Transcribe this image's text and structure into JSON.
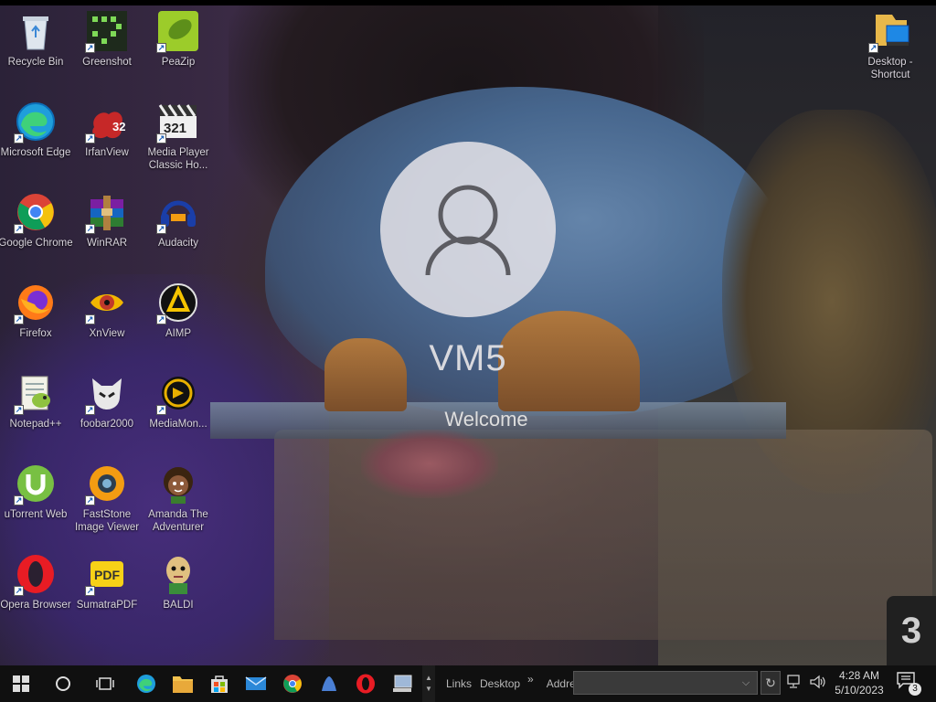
{
  "desktop": {
    "icons": [
      {
        "label": "Recycle Bin",
        "icon": "recycle-bin-icon"
      },
      {
        "label": "Greenshot",
        "icon": "greenshot-icon"
      },
      {
        "label": "PeaZip",
        "icon": "peazip-icon"
      },
      {
        "label": "Microsoft Edge",
        "icon": "edge-icon"
      },
      {
        "label": "IrfanView",
        "icon": "irfanview-icon"
      },
      {
        "label": "Media Player Classic Ho...",
        "icon": "mpc-icon"
      },
      {
        "label": "Google Chrome",
        "icon": "chrome-icon"
      },
      {
        "label": "WinRAR",
        "icon": "winrar-icon"
      },
      {
        "label": "Audacity",
        "icon": "audacity-icon"
      },
      {
        "label": "Firefox",
        "icon": "firefox-icon"
      },
      {
        "label": "XnView",
        "icon": "xnview-icon"
      },
      {
        "label": "AIMP",
        "icon": "aimp-icon"
      },
      {
        "label": "Notepad++",
        "icon": "notepadpp-icon"
      },
      {
        "label": "foobar2000",
        "icon": "foobar-icon"
      },
      {
        "label": "MediaMon...",
        "icon": "mediamonkey-icon"
      },
      {
        "label": "uTorrent Web",
        "icon": "utorrent-icon"
      },
      {
        "label": "FastStone Image Viewer",
        "icon": "faststone-icon"
      },
      {
        "label": "Amanda The Adventurer",
        "icon": "amanda-icon"
      },
      {
        "label": "Opera Browser",
        "icon": "opera-icon"
      },
      {
        "label": "SumatraPDF",
        "icon": "sumatrapdf-icon"
      },
      {
        "label": "BALDI",
        "icon": "baldi-icon"
      },
      {
        "label": "Desktop - Shortcut",
        "icon": "desktop-shortcut-icon"
      }
    ],
    "shortcut_glyph": "↗",
    "pdf_text": "PDF",
    "irfan_badge": "32",
    "mpc_badge": "321"
  },
  "login": {
    "user_name": "VM5",
    "status": "Welcome"
  },
  "corner_badge": "3",
  "taskbar": {
    "toolbar_links": "Links",
    "toolbar_desktop": "Desktop",
    "toolbar_overflow": "»",
    "address_label": "Address",
    "address_value": "",
    "clock_time": "4:28 AM",
    "clock_date": "5/10/2023",
    "notification_count": "3",
    "scroll_up": "▲",
    "scroll_down": "▼",
    "go_glyph": "↻",
    "dropdown_glyph": "⌵"
  },
  "colors": {
    "taskbar": "#101010",
    "accent_blue": "#1a73e8",
    "text": "#d8d4dc"
  }
}
